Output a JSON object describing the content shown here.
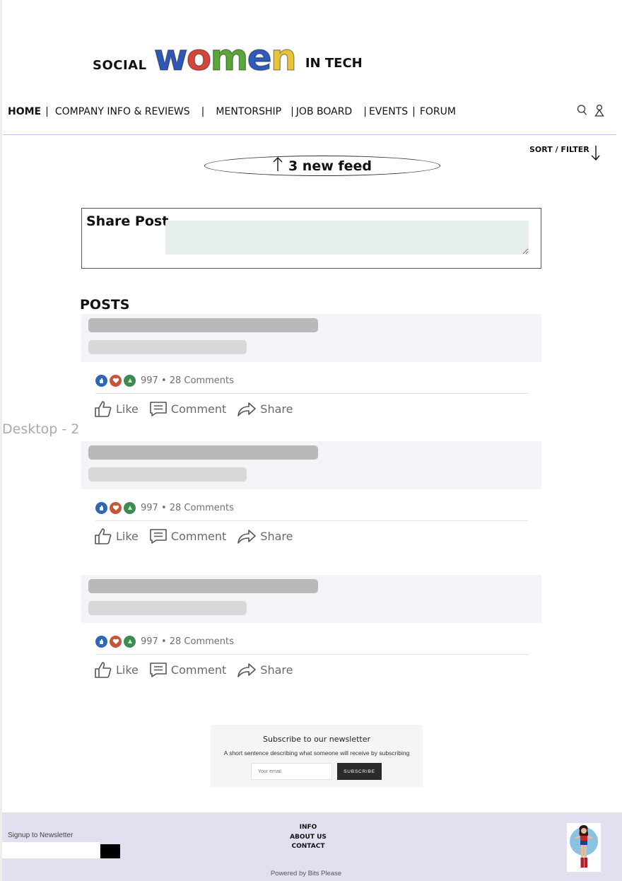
{
  "header": {
    "logo_social": "SOCIAL",
    "logo_women_letters": [
      {
        "char": "w",
        "color": "#2f58b6"
      },
      {
        "char": "o",
        "color": "#d6453a"
      },
      {
        "char": "m",
        "color": "#5aa63a"
      },
      {
        "char": "e",
        "color": "#2d5db8"
      },
      {
        "char": "n",
        "color": "#e8c43b"
      }
    ],
    "logo_tech": "IN TECH"
  },
  "nav": {
    "items": [
      {
        "label": "HOME",
        "active": true
      },
      {
        "label": "COMPANY INFO & REVIEWS"
      },
      {
        "label": "MENTORSHIP"
      },
      {
        "label": "JOB BOARD"
      },
      {
        "label": "EVENTS"
      },
      {
        "label": "FORUM"
      }
    ],
    "icons": [
      "search-icon",
      "user-icon"
    ]
  },
  "feed": {
    "sort_label": "SORT / FILTER",
    "new_feed_label": "3 new feed"
  },
  "share_post": {
    "label": "Share Post"
  },
  "posts_heading": "POSTS",
  "canvas_label": "Desktop - 2",
  "posts": [
    {
      "reactions": "997 • 28 Comments",
      "like": "Like",
      "comment": "Comment",
      "share": "Share"
    },
    {
      "reactions": "997 • 28 Comments",
      "like": "Like",
      "comment": "Comment",
      "share": "Share"
    },
    {
      "reactions": "997 • 28 Comments",
      "like": "Like",
      "comment": "Comment",
      "share": "Share"
    }
  ],
  "newsletter": {
    "title": "Subscribe to our newsletter",
    "subtitle": "A short sentence describing what someone will receive by subscribing",
    "email_placeholder": "Your email",
    "button": "SUBSCRIBE"
  },
  "footer": {
    "signup_label": "Signup to Newsletter",
    "links": [
      "INFO",
      "ABOUT US",
      "CONTACT"
    ],
    "powered_by": "Powered by Bits Please",
    "background": "#e1dff0"
  }
}
